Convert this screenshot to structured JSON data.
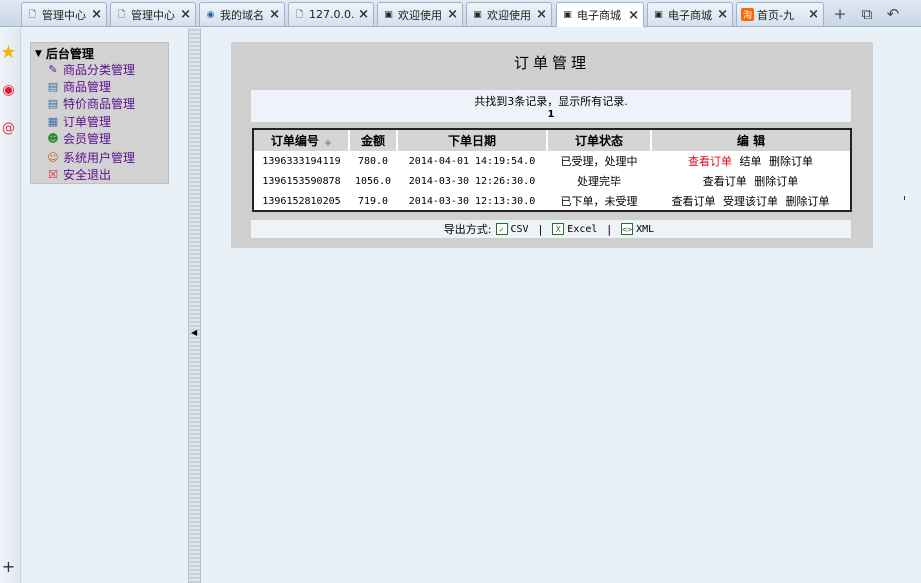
{
  "tabs": [
    {
      "label": "管理中心",
      "icon": "page-icon",
      "active": false
    },
    {
      "label": "管理中心",
      "icon": "page-icon",
      "active": false
    },
    {
      "label": "我的域名",
      "icon": "globe-icon",
      "active": false
    },
    {
      "label": "127.0.0.",
      "icon": "page-icon",
      "active": false
    },
    {
      "label": "欢迎使用",
      "icon": "image-icon",
      "active": false
    },
    {
      "label": "欢迎使用",
      "icon": "image-icon",
      "active": false
    },
    {
      "label": "电子商城",
      "icon": "image-icon",
      "active": true
    },
    {
      "label": "电子商城",
      "icon": "image-icon",
      "active": false
    },
    {
      "label": "首页-九",
      "icon": "taobao-icon",
      "active": false
    }
  ],
  "sidebar": {
    "title": "后台管理",
    "items": [
      {
        "label": "商品分类管理",
        "icon": "category-icon"
      },
      {
        "label": "商品管理",
        "icon": "product-icon"
      },
      {
        "label": "特价商品管理",
        "icon": "sale-icon"
      },
      {
        "label": "订单管理",
        "icon": "order-icon"
      },
      {
        "label": "会员管理",
        "icon": "members-icon"
      },
      {
        "label": "系统用户管理",
        "icon": "user-icon"
      },
      {
        "label": "安全退出",
        "icon": "exit-icon"
      }
    ]
  },
  "main": {
    "title": "订单管理",
    "summary": "共找到3条记录，显示所有记录.",
    "page": "1",
    "columns": [
      "订单编号",
      "金额",
      "下单日期",
      "订单状态",
      "编 辑"
    ],
    "rows": [
      {
        "id": "1396333194119",
        "amount": "780.0",
        "date": "2014-04-01 14:19:54.0",
        "status": "已受理，处理中",
        "actions": [
          "查看订单",
          "结单",
          "删除订单"
        ]
      },
      {
        "id": "1396153590878",
        "amount": "1056.0",
        "date": "2014-03-30 12:26:30.0",
        "status": "处理完毕",
        "actions": [
          "查看订单",
          "删除订单"
        ]
      },
      {
        "id": "1396152810205",
        "amount": "719.0",
        "date": "2014-03-30 12:13:30.0",
        "status": "已下单，未受理",
        "actions": [
          "查看订单",
          "受理该订单",
          "删除订单"
        ]
      }
    ],
    "export_label": "导出方式:",
    "export_options": [
      "CSV",
      "Excel",
      "XML"
    ]
  },
  "colors": {
    "hover_link": "#d8101e",
    "menu_link": "#5a0f8c",
    "panel_bg": "#cfcfcf"
  }
}
